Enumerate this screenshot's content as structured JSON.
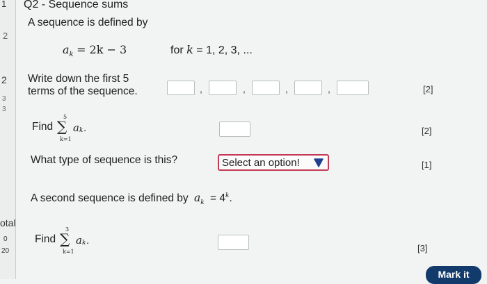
{
  "sidebar": {
    "num_1": "1",
    "num_2a": "2",
    "num_2": "2",
    "num_3a": "3",
    "num_3b": "3",
    "total_label": "otal",
    "score": "0",
    "max": "20"
  },
  "question": {
    "title": "Q2 - Sequence sums",
    "intro": "A sequence is defined by",
    "formula_lhs": "a",
    "formula_sub": "k",
    "formula_rhs": "= 2k − 3",
    "formula_for": "for",
    "formula_k": "k",
    "formula_range": "= 1, 2, 3, ..."
  },
  "part1": {
    "line1": "Write down the first 5",
    "line2": "terms of the sequence.",
    "marks": "[2]"
  },
  "part2": {
    "find": "Find",
    "sum_top": "5",
    "sum_bottom": "k=1",
    "term": "a",
    "term_sub": "k",
    "dot": ".",
    "marks": "[2]"
  },
  "part3": {
    "question": "What type of sequence is this?",
    "select_label": "Select an option!",
    "marks": "[1]"
  },
  "part4": {
    "intro": "A second sequence is defined by",
    "var": "a",
    "var_sub": "k",
    "equals": "= 4",
    "power": "k",
    "dot": "."
  },
  "part5": {
    "find": "Find",
    "sum_top": "3",
    "sum_bottom": "k=1",
    "term": "a",
    "term_sub": "k",
    "dot": ".",
    "marks": "[3]"
  },
  "buttons": {
    "mark_it": "Mark it"
  },
  "colors": {
    "select_border": "#c23a55",
    "button_bg": "#123a6b",
    "arrow": "#1f3f8f"
  }
}
